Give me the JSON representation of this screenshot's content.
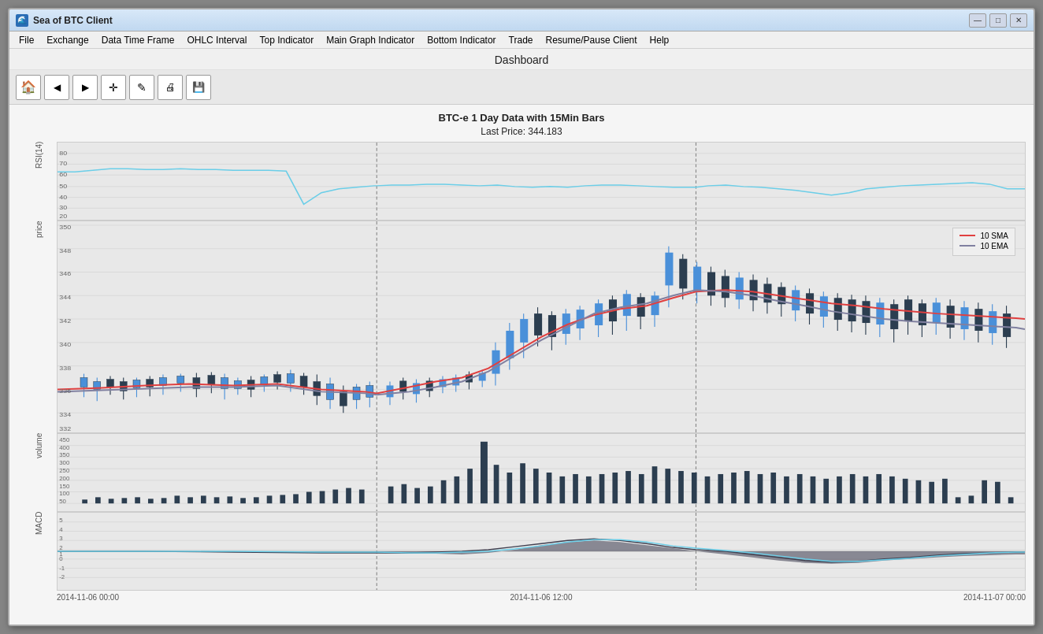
{
  "window": {
    "title": "Sea of BTC Client",
    "min_label": "—",
    "max_label": "□",
    "close_label": "✕"
  },
  "menu": {
    "items": [
      "File",
      "Exchange",
      "Data Time Frame",
      "OHLC Interval",
      "Top Indicator",
      "Main Graph Indicator",
      "Bottom Indicator",
      "Trade",
      "Resume/Pause Client",
      "Help"
    ]
  },
  "dashboard": {
    "title": "Dashboard"
  },
  "toolbar": {
    "buttons": [
      {
        "name": "home-button",
        "icon": "🏠"
      },
      {
        "name": "back-button",
        "icon": "◀"
      },
      {
        "name": "forward-button",
        "icon": "▶"
      },
      {
        "name": "add-button",
        "icon": "+"
      },
      {
        "name": "edit-button",
        "icon": "✎"
      },
      {
        "name": "print-button",
        "icon": "🖨"
      },
      {
        "name": "save-button",
        "icon": "💾"
      }
    ]
  },
  "chart": {
    "title_line1": "BTC-e 1 Day Data with 15Min Bars",
    "title_line2": "Last Price: 344.183",
    "rsi_label": "RSI(14)",
    "price_label": "price",
    "volume_label": "volume",
    "macd_label": "MACD",
    "legend": {
      "sma_label": "10 SMA",
      "ema_label": "10 EMA",
      "sma_color": "#e04040",
      "ema_color": "#8080a0"
    },
    "rsi_yticks": [
      "80",
      "70",
      "60",
      "50",
      "40",
      "30",
      "20"
    ],
    "price_yticks": [
      "350",
      "348",
      "346",
      "344",
      "342",
      "340",
      "338",
      "336",
      "334",
      "332"
    ],
    "volume_yticks": [
      "450",
      "400",
      "350",
      "300",
      "250",
      "200",
      "150",
      "100",
      "50"
    ],
    "macd_yticks": [
      "5",
      "4",
      "3",
      "2",
      "1",
      "0",
      "-1",
      "-2"
    ],
    "xticks": [
      "2014-11-06 00:00",
      "2014-11-06 12:00",
      "2014-11-07 00:00"
    ],
    "dashed_lines_x": [
      0.33,
      0.67
    ]
  }
}
